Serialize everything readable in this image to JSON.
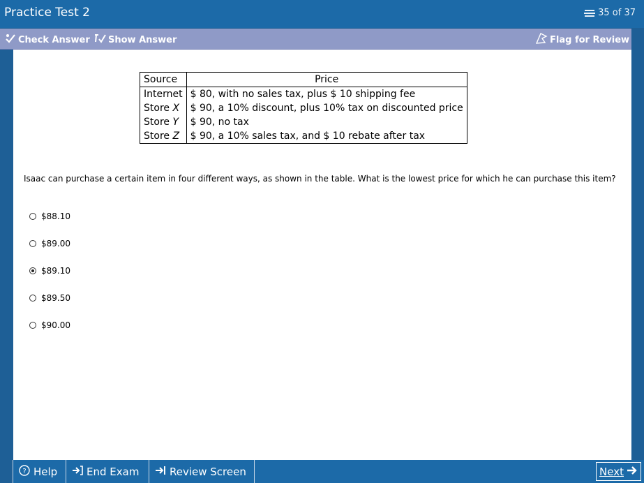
{
  "header": {
    "title": "Practice Test 2",
    "counter": "35 of 37"
  },
  "toolbar": {
    "check_answer": "Check Answer",
    "show_answer": "Show Answer",
    "flag_for_review": "Flag for Review"
  },
  "table": {
    "headers": [
      "Source",
      "Price"
    ],
    "rows": [
      {
        "source_prefix": "Internet",
        "source_var": "",
        "price": "$ 80, with no sales tax, plus $ 10 shipping fee"
      },
      {
        "source_prefix": "Store ",
        "source_var": "X",
        "price": "$ 90, a 10% discount, plus 10% tax on discounted price"
      },
      {
        "source_prefix": "Store ",
        "source_var": "Y",
        "price": "$ 90, no tax"
      },
      {
        "source_prefix": "Store ",
        "source_var": "Z",
        "price": "$ 90, a 10% sales tax, and $ 10 rebate after tax"
      }
    ]
  },
  "question": "Isaac can purchase a certain item in four different ways, as shown in the table.  What is the lowest price for which he can purchase this item?",
  "choices": [
    {
      "label": "$88.10",
      "selected": false
    },
    {
      "label": "$89.00",
      "selected": false
    },
    {
      "label": "$89.10",
      "selected": true
    },
    {
      "label": "$89.50",
      "selected": false
    },
    {
      "label": "$90.00",
      "selected": false
    }
  ],
  "footer": {
    "help": "Help",
    "end_exam": "End Exam",
    "review_screen": "Review Screen",
    "next": "Next"
  },
  "icons": {
    "counter": "stack-icon",
    "check_answer": "checkmark-icon",
    "show_answer": "show-answer-icon",
    "flag": "flag-icon",
    "help": "help-circle-icon",
    "end_exam": "end-exam-arrow-icon",
    "review_screen": "review-arrow-icon",
    "next": "right-arrow-icon"
  },
  "colors": {
    "title_bar": "#1c6aa8",
    "toolbar": "#8f9ac7",
    "frame": "#1e5f96"
  }
}
